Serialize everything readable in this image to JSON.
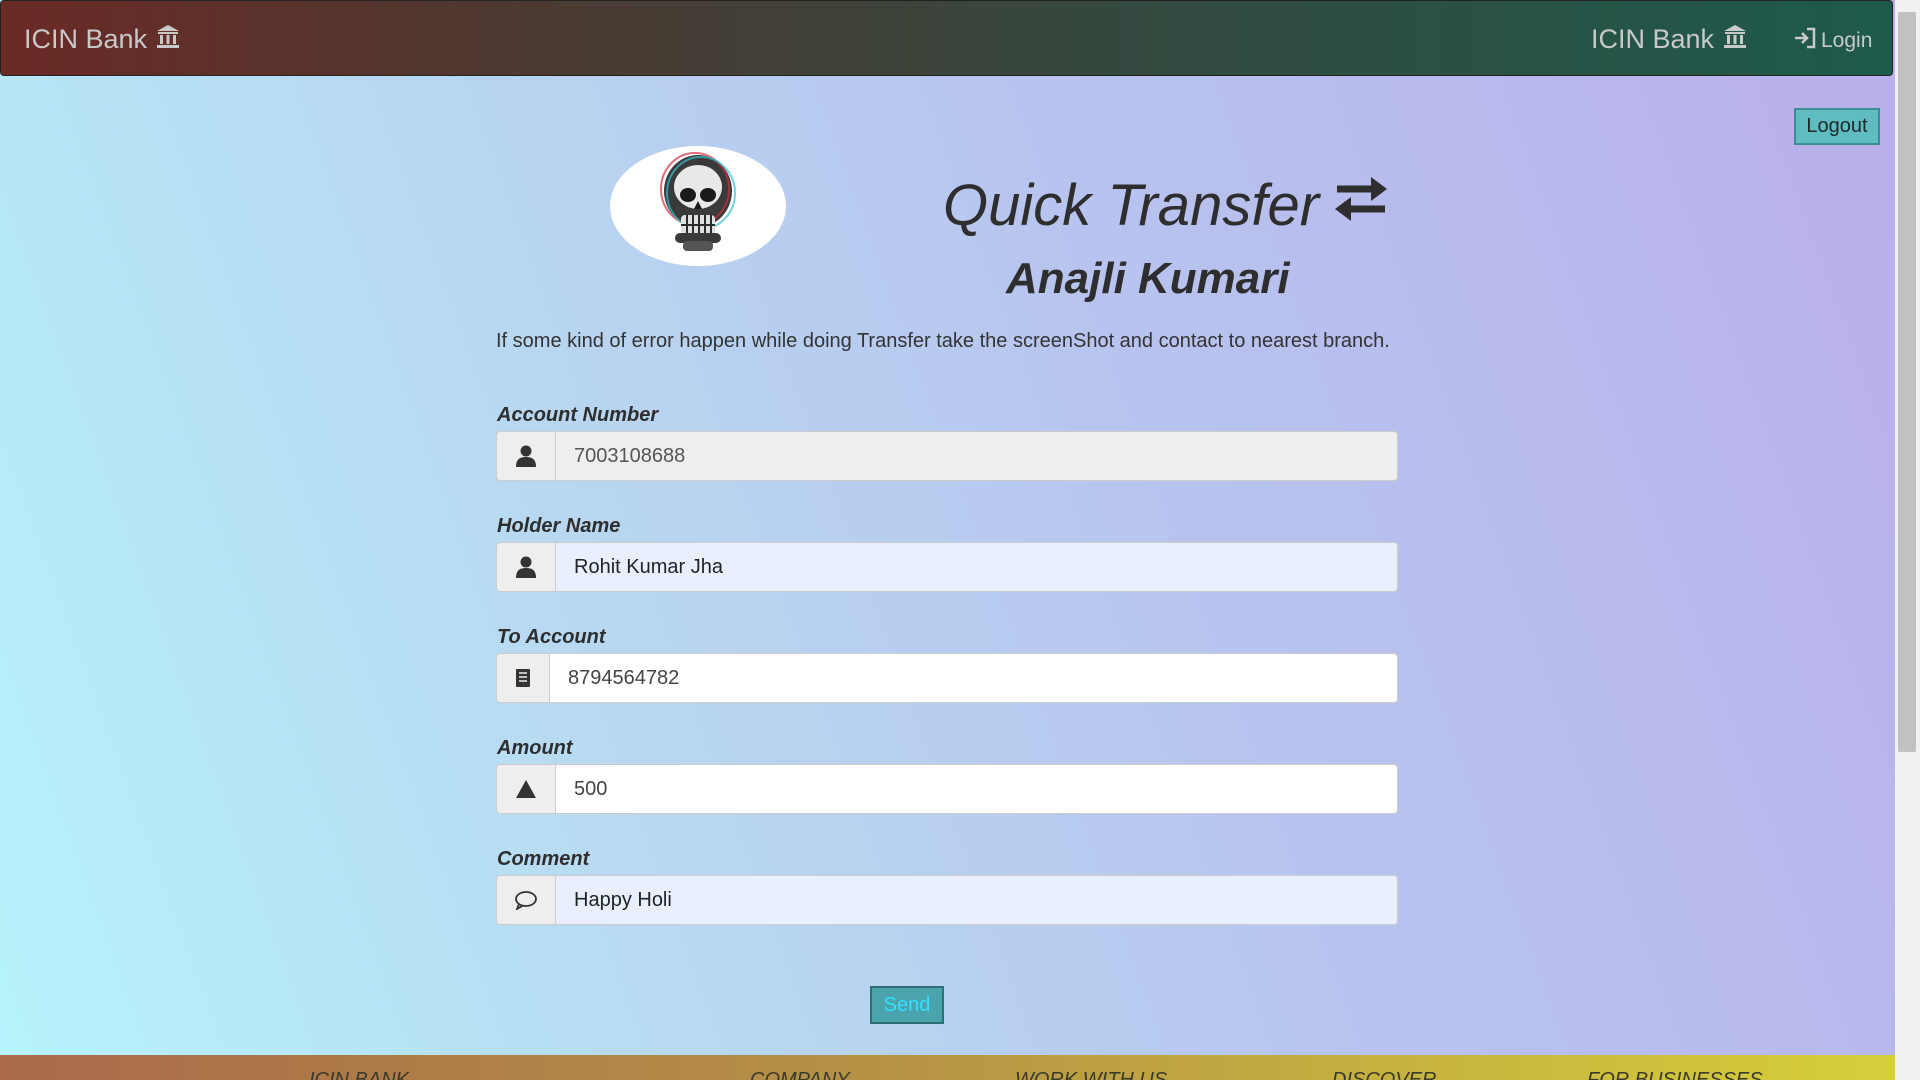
{
  "navbar": {
    "brand_left": "ICIN Bank",
    "brand_right": "ICIN Bank",
    "login_label": "Login",
    "brand_icon": "bank-icon",
    "login_icon": "sign-in-icon"
  },
  "logout_label": "Logout",
  "avatar_icon": "skull-icon",
  "title": "Quick Transfer",
  "title_icon": "transfer-arrows-icon",
  "holder_name": "Anajli Kumari",
  "notice": "If some kind of error happen while doing Transfer take the screenShot and contact to nearest branch.",
  "form": {
    "account_number": {
      "label": "Account Number",
      "value": "7003108688",
      "icon": "user-icon"
    },
    "holder_name": {
      "label": "Holder Name",
      "value": "Rohit Kumar Jha",
      "icon": "user-icon"
    },
    "to_account": {
      "label": "To Account",
      "value": "8794564782",
      "icon": "list-icon"
    },
    "amount": {
      "label": "Amount",
      "value": "500",
      "icon": "triangle-icon"
    },
    "comment": {
      "label": "Comment",
      "value": "Happy Holi",
      "icon": "comment-icon"
    },
    "send_label": "Send"
  },
  "footer": {
    "items": [
      "ICIN BANK",
      "COMPANY",
      "WORK WITH US",
      "DISCOVER",
      "FOR BUSINESSES"
    ]
  },
  "colors": {
    "logout_bg": "#5fbcc1",
    "send_bg": "#4ba3ad",
    "send_text": "#33e0ff"
  }
}
